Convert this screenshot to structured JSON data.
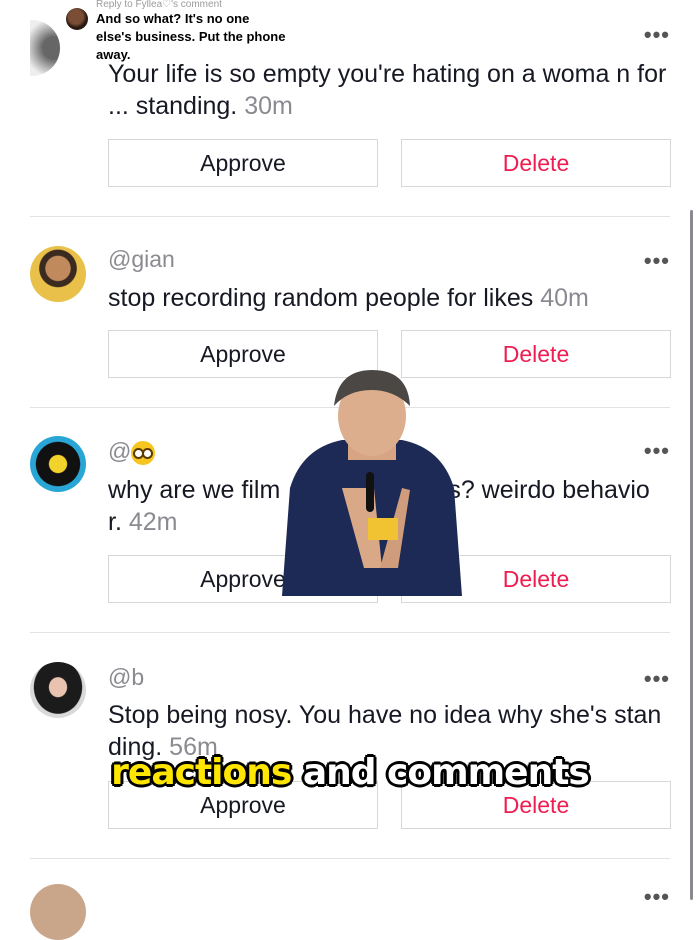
{
  "reply_bubble": {
    "header": "Reply to Fyllea♡'s comment",
    "text": "And so what? It's no one else's business. Put the phone away."
  },
  "comments": [
    {
      "text": "Your life is so empty you're hating on a woma n for ... standing.",
      "time": "30m",
      "approve": "Approve",
      "delete": "Delete"
    },
    {
      "handle": "@gian",
      "text": "stop recording random people for likes",
      "time": "40m",
      "approve": "Approve",
      "delete": "Delete"
    },
    {
      "handle": "@",
      "handle_emoji": "nerd-face-emoji",
      "text_left": "why are we film",
      "text_right": "rs? weirdo behavio",
      "text_line2": "r.",
      "time": "42m",
      "approve": "Approve",
      "delete": "Delete"
    },
    {
      "handle": "@b",
      "text": "Stop being nosy. You have no idea why she's standing.",
      "time": "56m",
      "approve": "Approve",
      "delete": "Delete"
    }
  ],
  "more_label": "•••",
  "caption": {
    "word1": "reactions",
    "rest": " and comments"
  },
  "colors": {
    "delete": "#ee1d52",
    "caption_highlight": "#ffe600"
  }
}
